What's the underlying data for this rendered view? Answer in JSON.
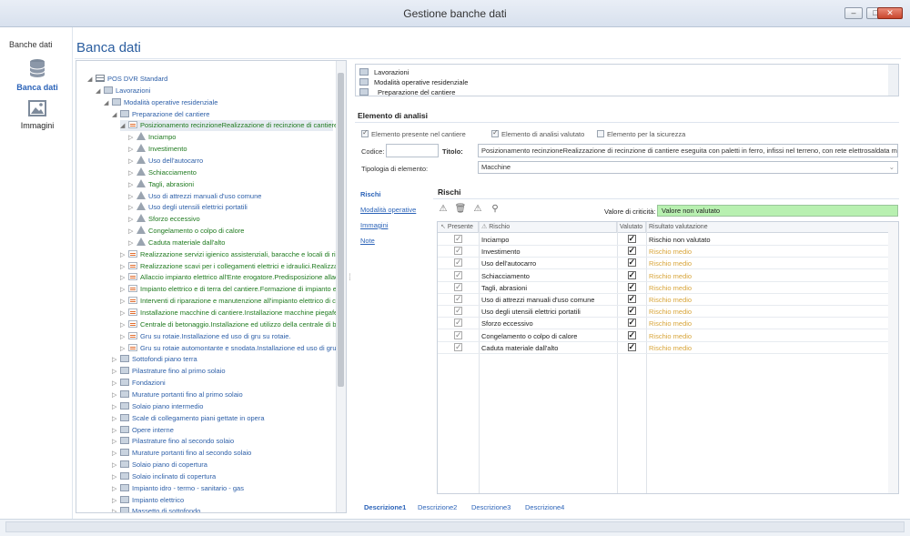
{
  "window": {
    "title": "Gestione banche dati"
  },
  "nav": {
    "tab_label": "Banche dati",
    "items": [
      {
        "label": "Banca dati",
        "icon": "database-icon",
        "active": true
      },
      {
        "label": "Immagini",
        "icon": "image-icon",
        "active": false
      }
    ]
  },
  "page": {
    "title": "Banca dati"
  },
  "tree": [
    {
      "label": "POS DVR  Standard",
      "level": 0,
      "icon": "grid",
      "color": "blue"
    },
    {
      "label": "Lavorazioni",
      "level": 1,
      "icon": "folder",
      "color": "blue"
    },
    {
      "label": "Modalità operative residenziale",
      "level": 2,
      "icon": "folder",
      "color": "blue"
    },
    {
      "label": "Preparazione del cantiere",
      "level": 3,
      "icon": "folder",
      "color": "blue"
    },
    {
      "label": "Posizionamento recinzioneRealizzazione di recinzione di cantiere e...",
      "level": 4,
      "icon": "doc",
      "color": "green",
      "selected": true
    },
    {
      "label": "Inciampo",
      "level": 5,
      "icon": "warn",
      "color": "green"
    },
    {
      "label": "Investimento",
      "level": 5,
      "icon": "warn",
      "color": "green"
    },
    {
      "label": "Uso dell'autocarro",
      "level": 5,
      "icon": "warn",
      "color": "blue"
    },
    {
      "label": "Schiacciamento",
      "level": 5,
      "icon": "warn",
      "color": "green"
    },
    {
      "label": "Tagli, abrasioni",
      "level": 5,
      "icon": "warn",
      "color": "green"
    },
    {
      "label": "Uso di attrezzi manuali d'uso comune",
      "level": 5,
      "icon": "warn",
      "color": "blue"
    },
    {
      "label": "Uso degli utensili elettrici portatili",
      "level": 5,
      "icon": "warn",
      "color": "blue"
    },
    {
      "label": "Sforzo eccessivo",
      "level": 5,
      "icon": "warn",
      "color": "green"
    },
    {
      "label": "Congelamento o colpo di calore",
      "level": 5,
      "icon": "warn",
      "color": "green"
    },
    {
      "label": "Caduta materiale dall'alto",
      "level": 5,
      "icon": "warn",
      "color": "green"
    },
    {
      "label": "Realizzazione servizi igienico assistenziali, baracche e locali di rime...",
      "level": 4,
      "icon": "doc",
      "color": "green"
    },
    {
      "label": "Realizzazione scavi per i collegamenti elettrici e idraulici.Realizzazi...",
      "level": 4,
      "icon": "doc",
      "color": "green"
    },
    {
      "label": "Allaccio impianto elettrico all'Ente erogatore.Predisposizione allacc...",
      "level": 4,
      "icon": "doc",
      "color": "green"
    },
    {
      "label": "Impianto elettrico e di terra del cantiere.Formazione di impianto e...",
      "level": 4,
      "icon": "doc",
      "color": "green"
    },
    {
      "label": "Interventi di riparazione e manutenzione all'impianto elettrico di ca...",
      "level": 4,
      "icon": "doc",
      "color": "green"
    },
    {
      "label": "Installazione macchine di cantiere.Installazione macchine piegafer...",
      "level": 4,
      "icon": "doc",
      "color": "green"
    },
    {
      "label": "Centrale di betonaggio.Installazione ed utilizzo della centrale di be...",
      "level": 4,
      "icon": "doc",
      "color": "green"
    },
    {
      "label": "Gru su rotaie.Installazione ed uso di gru su rotaie.",
      "level": 4,
      "icon": "doc",
      "color": "blue"
    },
    {
      "label": "Gru su rotaie automontante e snodata.Installazione ed uso di gru...",
      "level": 4,
      "icon": "doc",
      "color": "blue"
    },
    {
      "label": "Sottofondi piano terra",
      "level": 3,
      "icon": "folder",
      "color": "blue"
    },
    {
      "label": "Pilastrature fino al primo solaio",
      "level": 3,
      "icon": "folder",
      "color": "blue"
    },
    {
      "label": "Fondazioni",
      "level": 3,
      "icon": "folder",
      "color": "blue"
    },
    {
      "label": "Murature portanti fino al primo solaio",
      "level": 3,
      "icon": "folder",
      "color": "blue"
    },
    {
      "label": "Solaio piano intermedio",
      "level": 3,
      "icon": "folder",
      "color": "blue"
    },
    {
      "label": "Scale di collegamento piani gettate in opera",
      "level": 3,
      "icon": "folder",
      "color": "blue"
    },
    {
      "label": "Opere interne",
      "level": 3,
      "icon": "folder",
      "color": "blue"
    },
    {
      "label": "Pilastrature fino al secondo solaio",
      "level": 3,
      "icon": "folder",
      "color": "blue"
    },
    {
      "label": "Murature portanti fino al secondo solaio",
      "level": 3,
      "icon": "folder",
      "color": "blue"
    },
    {
      "label": "Solaio piano di copertura",
      "level": 3,
      "icon": "folder",
      "color": "blue"
    },
    {
      "label": "Solaio inclinato di copertura",
      "level": 3,
      "icon": "folder",
      "color": "blue"
    },
    {
      "label": "Impianto idro - termo - sanitario - gas",
      "level": 3,
      "icon": "folder",
      "color": "blue"
    },
    {
      "label": "Impianto elettrico",
      "level": 3,
      "icon": "folder",
      "color": "blue"
    },
    {
      "label": "Massetto di sottofondo",
      "level": 3,
      "icon": "folder",
      "color": "blue"
    }
  ],
  "path": [
    "Lavorazioni",
    "Modalità operative residenziale",
    "Preparazione del cantiere"
  ],
  "element": {
    "section_title": "Elemento di analisi",
    "chk_present": "Elemento presente nel cantiere",
    "chk_evaluated": "Elemento di analisi valutato",
    "chk_safety": "Elemento per la sicurezza",
    "code_label": "Codice:",
    "code_value": "",
    "title_label": "Titolo:",
    "title_value": "Posizionamento recinzioneRealizzazione di recinzione di cantiere eseguita con paletti in ferro, infissi nel terreno, con rete elettrosaldata metallic",
    "type_label": "Tipologia di elemento:",
    "type_value": "Macchine"
  },
  "subnav": [
    "Rischi",
    "Modalità operative",
    "Immagini",
    "Note"
  ],
  "rischi": {
    "title": "Rischi",
    "criticita_label": "Valore di criticità:",
    "criticita_value": "Valore non valutato",
    "criticita_color": "#b8f0b0",
    "headers": {
      "presente": "Presente",
      "rischio": "Rischio",
      "valutato": "Valutato",
      "risultato": "Risultato valutazione"
    },
    "rows": [
      {
        "rischio": "Inciampo",
        "risultato": "Rischio non valutato",
        "status": "none"
      },
      {
        "rischio": "Investimento",
        "risultato": "Rischio medio",
        "status": "medio"
      },
      {
        "rischio": "Uso dell'autocarro",
        "risultato": "Rischio medio",
        "status": "medio"
      },
      {
        "rischio": "Schiacciamento",
        "risultato": "Rischio medio",
        "status": "medio"
      },
      {
        "rischio": "Tagli, abrasioni",
        "risultato": "Rischio medio",
        "status": "medio"
      },
      {
        "rischio": "Uso di attrezzi manuali d'uso comune",
        "risultato": "Rischio medio",
        "status": "medio"
      },
      {
        "rischio": "Uso degli utensili elettrici portatili",
        "risultato": "Rischio medio",
        "status": "medio"
      },
      {
        "rischio": "Sforzo eccessivo",
        "risultato": "Rischio medio",
        "status": "medio"
      },
      {
        "rischio": "Congelamento o colpo di calore",
        "risultato": "Rischio medio",
        "status": "medio"
      },
      {
        "rischio": "Caduta materiale dall'alto",
        "risultato": "Rischio medio",
        "status": "medio"
      }
    ]
  },
  "bottom_tabs": [
    "Descrizione1",
    "Descrizione2",
    "Descrizione3",
    "Descrizione4"
  ]
}
